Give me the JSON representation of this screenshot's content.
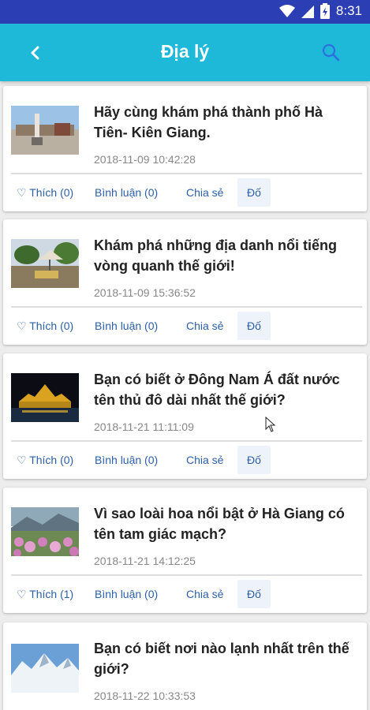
{
  "status": {
    "time": "8:31"
  },
  "appbar": {
    "title": "Địa lý",
    "back_icon": "arrow-left-icon",
    "search_icon": "search-icon"
  },
  "colors": {
    "statusbar": "#2c3eb3",
    "appbar": "#1eb8d8",
    "action_text": "#2c5fa8",
    "search_icon": "#2d6fe0"
  },
  "posts": [
    {
      "title": "Hãy cùng khám phá thành phố Hà Tiên- Kiên Giang.",
      "date": "2018-11-09 10:42:28",
      "like": "♡ Thích (0)",
      "comment": "Bình luận (0)",
      "share": "Chia sẻ",
      "read": "Đố"
    },
    {
      "title": "Khám phá những địa danh nổi tiếng vòng quanh thế giới!",
      "date": "2018-11-09 15:36:52",
      "like": "♡ Thích (0)",
      "comment": "Bình luận (0)",
      "share": "Chia sẻ",
      "read": "Đố"
    },
    {
      "title": " Bạn có biết ở Đông Nam Á đất nước tên thủ đô dài nhất thế giới?",
      "date": "2018-11-21 11:11:09",
      "like": "♡ Thích (0)",
      "comment": "Bình luận (0)",
      "share": "Chia sẻ",
      "read": "Đố"
    },
    {
      "title": "Vì sao loài hoa nổi bật ở Hà Giang có tên tam giác mạch?",
      "date": "2018-11-21 14:12:25",
      "like": "♡ Thích (1)",
      "comment": "Bình luận (0)",
      "share": "Chia sẻ",
      "read": "Đố"
    },
    {
      "title": "Bạn có biết nơi nào lạnh nhất trên thế giới?",
      "date": "2018-11-22 10:33:53"
    }
  ]
}
